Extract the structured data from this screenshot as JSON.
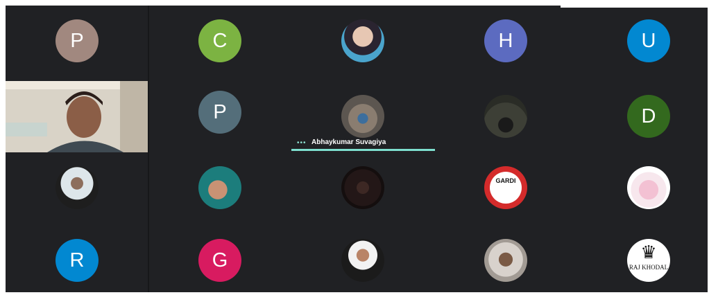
{
  "colors": {
    "background": "#202124",
    "active_speaker": "#7ee0cf"
  },
  "participants": [
    {
      "initial": "P",
      "color": "#a1887f"
    },
    {
      "initial": "C",
      "color": "#7cb342"
    },
    {
      "photo": "profile-photo"
    },
    {
      "initial": "H",
      "color": "#5c6bc0"
    },
    {
      "initial": "U",
      "color": "#0288d1"
    },
    {
      "video": "self-camera"
    },
    {
      "initial": "P",
      "color": "#546e7a"
    },
    {
      "photo": "profile-photo",
      "active_speaker": true
    },
    {
      "photo": "motorcycle-photo"
    },
    {
      "initial": "D",
      "color": "#33691e"
    },
    {
      "photo": "profile-photo"
    },
    {
      "photo": "profile-photo"
    },
    {
      "photo": "profile-photo"
    },
    {
      "photo": "gardi-logo",
      "logo_text": "GARDI"
    },
    {
      "photo": "teddy-bear-photo"
    },
    {
      "initial": "R",
      "color": "#0288d1"
    },
    {
      "initial": "G",
      "color": "#d81b60"
    },
    {
      "photo": "profile-photo"
    },
    {
      "photo": "profile-photo"
    },
    {
      "photo": "crown-logo",
      "logo_text": "RAJ KHODAL"
    }
  ],
  "active_speaker_name": "Abhaykumar Suvagiya"
}
